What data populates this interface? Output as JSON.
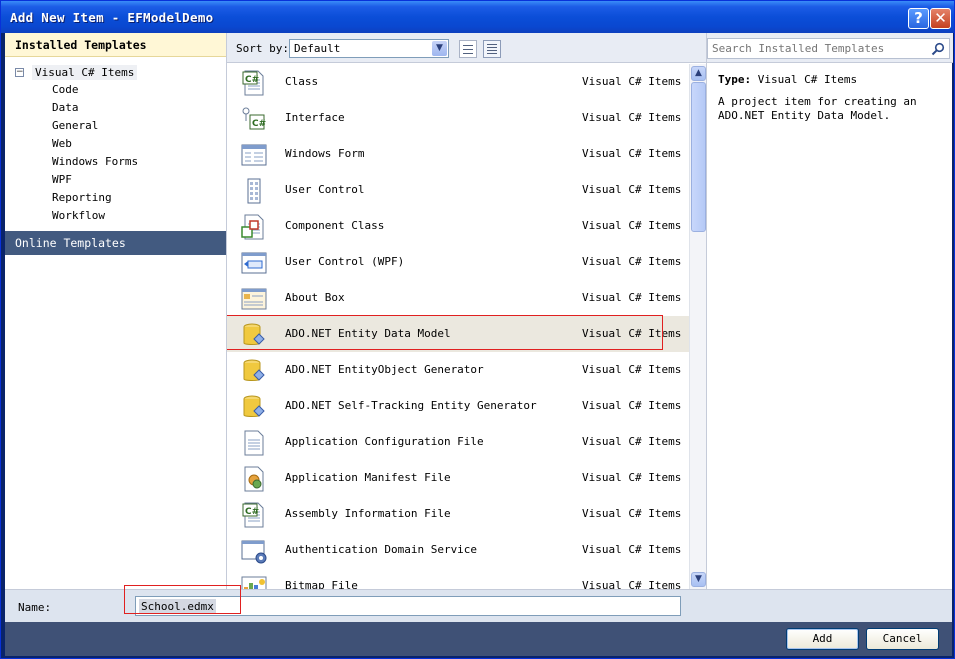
{
  "window": {
    "title": "Add New Item - EFModelDemo",
    "help_glyph": "?",
    "close_glyph": "✕"
  },
  "nav": {
    "installed_header": "Installed Templates",
    "root": {
      "toggle": "−",
      "label": "Visual C# Items"
    },
    "items": [
      "Code",
      "Data",
      "General",
      "Web",
      "Windows Forms",
      "WPF",
      "Reporting",
      "Workflow"
    ],
    "online": "Online Templates"
  },
  "toolbar": {
    "sort_label": "Sort by:",
    "sort_value": "Default"
  },
  "search": {
    "placeholder": "Search Installed Templates"
  },
  "templates": [
    {
      "name": "Class",
      "category": "Visual C# Items",
      "icon": "class-icon"
    },
    {
      "name": "Interface",
      "category": "Visual C# Items",
      "icon": "interface-icon"
    },
    {
      "name": "Windows Form",
      "category": "Visual C# Items",
      "icon": "windows-form-icon"
    },
    {
      "name": "User Control",
      "category": "Visual C# Items",
      "icon": "user-control-icon"
    },
    {
      "name": "Component Class",
      "category": "Visual C# Items",
      "icon": "component-class-icon"
    },
    {
      "name": "User Control (WPF)",
      "category": "Visual C# Items",
      "icon": "wpf-user-control-icon"
    },
    {
      "name": "About Box",
      "category": "Visual C# Items",
      "icon": "about-box-icon"
    },
    {
      "name": "ADO.NET Entity Data Model",
      "category": "Visual C# Items",
      "icon": "database-icon",
      "selected": true
    },
    {
      "name": "ADO.NET EntityObject Generator",
      "category": "Visual C# Items",
      "icon": "database-icon"
    },
    {
      "name": "ADO.NET Self-Tracking Entity Generator",
      "category": "Visual C# Items",
      "icon": "database-icon"
    },
    {
      "name": "Application Configuration File",
      "category": "Visual C# Items",
      "icon": "config-file-icon"
    },
    {
      "name": "Application Manifest File",
      "category": "Visual C# Items",
      "icon": "manifest-file-icon"
    },
    {
      "name": "Assembly Information File",
      "category": "Visual C# Items",
      "icon": "assembly-info-icon"
    },
    {
      "name": "Authentication Domain Service",
      "category": "Visual C# Items",
      "icon": "domain-service-icon"
    },
    {
      "name": "Bitmap File",
      "category": "Visual C# Items",
      "icon": "bitmap-icon"
    }
  ],
  "details": {
    "type_label": "Type:",
    "type_value": "Visual C# Items",
    "description": "A project item for creating an ADO.NET Entity Data Model."
  },
  "name_field": {
    "label": "Name:",
    "value": "School.edmx"
  },
  "buttons": {
    "add": "Add",
    "cancel": "Cancel"
  },
  "colors": {
    "titlebar": "#0b4ed8",
    "selected_row": "#ebe8df",
    "annotation_box": "#e02020",
    "online_templates_bg": "#425a80",
    "button_bar_bg": "#3f5176"
  }
}
